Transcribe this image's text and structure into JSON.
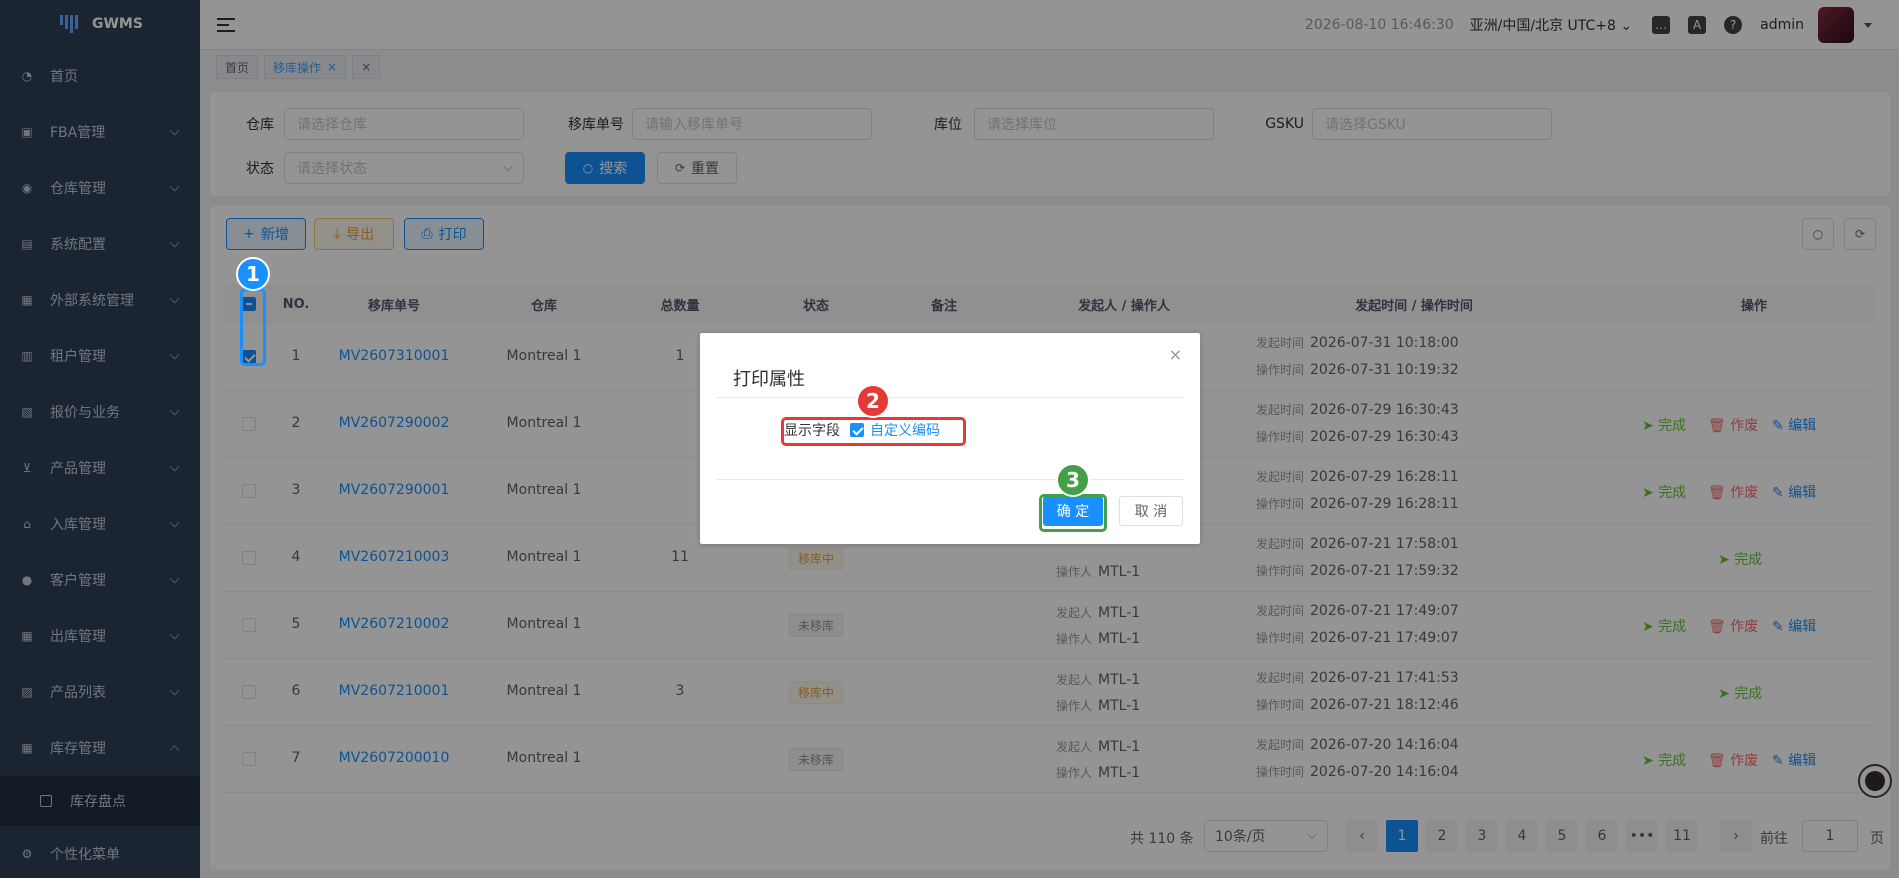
{
  "app": {
    "name": "GWMS"
  },
  "sidebar": {
    "items": [
      {
        "label": "首页",
        "icon": "dashboard-icon",
        "expand": false
      },
      {
        "label": "FBA管理",
        "icon": "box-icon",
        "expand": true
      },
      {
        "label": "仓库管理",
        "icon": "globe-icon",
        "expand": true
      },
      {
        "label": "系统配置",
        "icon": "settings-icon",
        "expand": true
      },
      {
        "label": "外部系统管理",
        "icon": "grid-icon",
        "expand": true
      },
      {
        "label": "租户管理",
        "icon": "chart-icon",
        "expand": true
      },
      {
        "label": "报价与业务",
        "icon": "document-icon",
        "expand": true
      },
      {
        "label": "产品管理",
        "icon": "cart-icon",
        "expand": true
      },
      {
        "label": "入库管理",
        "icon": "home-icon",
        "expand": true
      },
      {
        "label": "客户管理",
        "icon": "user-icon",
        "expand": true
      },
      {
        "label": "出库管理",
        "icon": "grid-icon",
        "expand": true
      },
      {
        "label": "产品列表",
        "icon": "book-icon",
        "expand": true
      },
      {
        "label": "库存管理",
        "icon": "table-icon",
        "expand": true,
        "open": true
      }
    ],
    "submenu": {
      "label": "库存盘点",
      "icon": "checkbox-icon"
    },
    "footer": {
      "label": "个性化菜单",
      "icon": "gear-icon"
    }
  },
  "header": {
    "datetime": "2026-08-10 16:46:30",
    "timezone": "亚洲/中国/北京 UTC+8",
    "user": "admin"
  },
  "tabs": [
    {
      "label": "首页",
      "active": false
    },
    {
      "label": "移库操作",
      "active": true,
      "close": "×"
    },
    {
      "label": "×",
      "active": false
    }
  ],
  "search": {
    "warehouse": {
      "label": "仓库",
      "placeholder": "请选择仓库"
    },
    "move_no": {
      "label": "移库单号",
      "placeholder": "请输入移库单号"
    },
    "location": {
      "label": "库位",
      "placeholder": "请选择库位"
    },
    "gsku": {
      "label": "GSKU",
      "placeholder": "请选择GSKU"
    },
    "status": {
      "label": "状态",
      "placeholder": "请选择状态"
    },
    "search_btn": "搜索",
    "reset_btn": "重置"
  },
  "toolbar": {
    "add": "新增",
    "export": "导出",
    "print": "打印"
  },
  "table": {
    "columns": [
      "NO.",
      "移库单号",
      "仓库",
      "总数量",
      "状态",
      "备注",
      "发起人 / 操作人",
      "发起时间 / 操作时间",
      "操作"
    ],
    "label_initiator": "发起人",
    "label_operator": "操作人",
    "label_start_time": "发起时间",
    "label_op_time": "操作时间",
    "action_done": "完成",
    "action_void": "作废",
    "action_edit": "编辑",
    "rows": [
      {
        "no": "1",
        "id": "MV2607310001",
        "warehouse": "Montreal 1",
        "qty": "1",
        "status": "",
        "initiator": "",
        "operator": "",
        "start": "2026-07-31 10:18:00",
        "op": "2026-07-31 10:19:32",
        "checked": true,
        "actions": []
      },
      {
        "no": "2",
        "id": "MV2607290002",
        "warehouse": "Montreal 1",
        "qty": "",
        "status": "",
        "initiator": "",
        "operator": "",
        "start": "2026-07-29 16:30:43",
        "op": "2026-07-29 16:30:43",
        "checked": false,
        "actions": [
          "done",
          "void",
          "edit"
        ]
      },
      {
        "no": "3",
        "id": "MV2607290001",
        "warehouse": "Montreal 1",
        "qty": "",
        "status": "",
        "initiator": "",
        "operator": "",
        "start": "2026-07-29 16:28:11",
        "op": "2026-07-29 16:28:11",
        "checked": false,
        "actions": [
          "done",
          "void",
          "edit"
        ]
      },
      {
        "no": "4",
        "id": "MV2607210003",
        "warehouse": "Montreal 1",
        "qty": "11",
        "status": "移库中",
        "initiator": "",
        "operator": "MTL-1",
        "start": "2026-07-21 17:58:01",
        "op": "2026-07-21 17:59:32",
        "checked": false,
        "actions": [
          "done"
        ]
      },
      {
        "no": "5",
        "id": "MV2607210002",
        "warehouse": "Montreal 1",
        "qty": "",
        "status": "未移库",
        "initiator": "MTL-1",
        "operator": "MTL-1",
        "start": "2026-07-21 17:49:07",
        "op": "2026-07-21 17:49:07",
        "checked": false,
        "actions": [
          "done",
          "void",
          "edit"
        ]
      },
      {
        "no": "6",
        "id": "MV2607210001",
        "warehouse": "Montreal 1",
        "qty": "3",
        "status": "移库中",
        "initiator": "MTL-1",
        "operator": "MTL-1",
        "start": "2026-07-21 17:41:53",
        "op": "2026-07-21 18:12:46",
        "checked": false,
        "actions": [
          "done"
        ]
      },
      {
        "no": "7",
        "id": "MV2607200010",
        "warehouse": "Montreal 1",
        "qty": "",
        "status": "未移库",
        "initiator": "MTL-1",
        "operator": "MTL-1",
        "start": "2026-07-20 14:16:04",
        "op": "2026-07-20 14:16:04",
        "checked": false,
        "actions": [
          "done",
          "void",
          "edit"
        ]
      }
    ]
  },
  "pagination": {
    "total": "共 110 条",
    "page_size": "10条/页",
    "pages": [
      "1",
      "2",
      "3",
      "4",
      "5",
      "6",
      "•••",
      "11"
    ],
    "current": "1",
    "goto_label": "前往",
    "goto_value": "1",
    "page_suffix": "页",
    "prev": "‹",
    "next": "›"
  },
  "dialog": {
    "title": "打印属性",
    "field_label": "显示字段",
    "option": "自定义编码",
    "option_checked": true,
    "ok": "确 定",
    "cancel": "取 消",
    "close": "×"
  },
  "annotations": [
    {
      "number": "1",
      "color": "#1890ff"
    },
    {
      "number": "2",
      "color": "#e53935"
    },
    {
      "number": "3",
      "color": "#43a047"
    }
  ]
}
